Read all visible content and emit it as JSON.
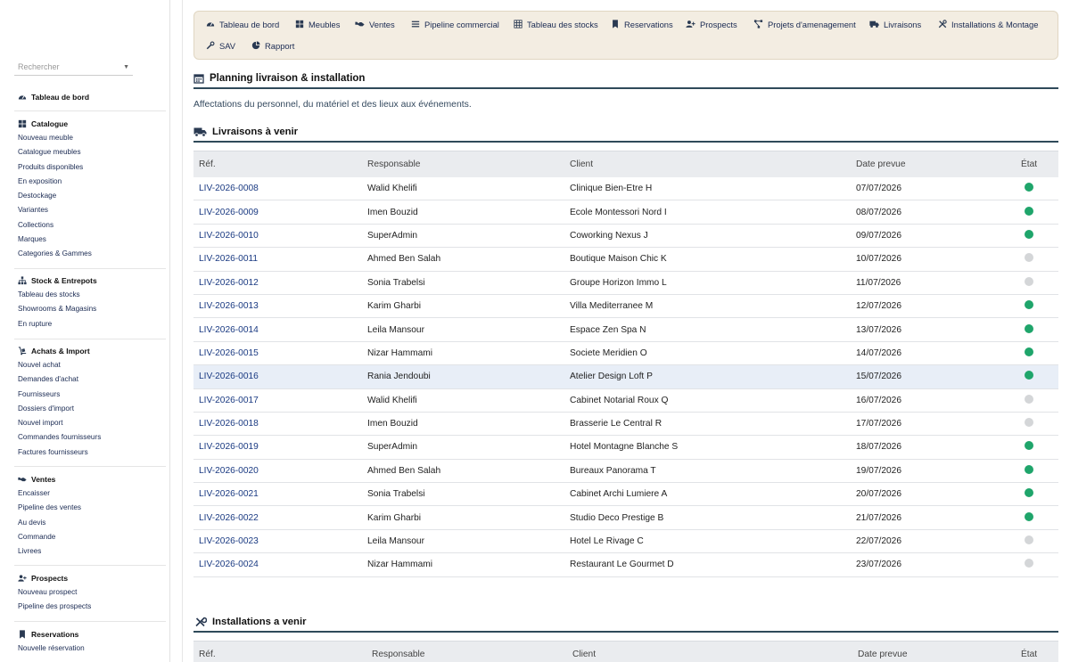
{
  "search": {
    "placeholder": "Rechercher"
  },
  "sidebar": {
    "sections": [
      {
        "title": "Tableau de bord",
        "icon": "gauge-icon",
        "items": []
      },
      {
        "title": "Catalogue",
        "icon": "grid-icon",
        "items": [
          "Nouveau meuble",
          "Catalogue meubles",
          "Produits disponibles",
          "En exposition",
          "Destockage",
          "Variantes",
          "Collections",
          "Marques",
          "Categories & Gammes"
        ]
      },
      {
        "title": "Stock & Entrepots",
        "icon": "sitemap-icon",
        "items": [
          "Tableau des stocks",
          "Showrooms & Magasins",
          "En rupture"
        ]
      },
      {
        "title": "Achats & Import",
        "icon": "dolly-icon",
        "items": [
          "Nouvel achat",
          "Demandes d'achat",
          "Fournisseurs",
          "Dossiers d'import",
          "Nouvel import",
          "Commandes fournisseurs",
          "Factures fournisseurs"
        ]
      },
      {
        "title": "Ventes",
        "icon": "handshake-icon",
        "items": [
          "Encaisser",
          "Pipeline des ventes",
          "Au devis",
          "Commande",
          "Livrees"
        ]
      },
      {
        "title": "Prospects",
        "icon": "user-plus-icon",
        "items": [
          "Nouveau prospect",
          "Pipeline des prospects"
        ]
      },
      {
        "title": "Reservations",
        "icon": "bookmark-icon",
        "items": [
          "Nouvelle réservation"
        ]
      }
    ]
  },
  "topbar": {
    "items": [
      {
        "label": "Tableau de bord",
        "icon": "gauge-icon"
      },
      {
        "label": "Meubles",
        "icon": "grid-icon"
      },
      {
        "label": "Ventes",
        "icon": "handshake-icon"
      },
      {
        "label": "Pipeline commercial",
        "icon": "bars-icon"
      },
      {
        "label": "Tableau des stocks",
        "icon": "table-icon"
      },
      {
        "label": "Reservations",
        "icon": "bookmark-icon"
      },
      {
        "label": "Prospects",
        "icon": "user-plus-icon"
      },
      {
        "label": "Projets d'amenagement",
        "icon": "project-diagram-icon"
      },
      {
        "label": "Livraisons",
        "icon": "truck-icon"
      },
      {
        "label": "Installations & Montage",
        "icon": "tools-icon"
      },
      {
        "label": "SAV",
        "icon": "wrench-icon"
      },
      {
        "label": "Rapport",
        "icon": "chart-pie-icon"
      }
    ]
  },
  "page": {
    "title": "Planning livraison & installation",
    "subtitle": "Affectations du personnel, du matériel et des lieux aux événements."
  },
  "deliveries": {
    "title": "Livraisons à venir",
    "columns": [
      "Réf.",
      "Responsable",
      "Client",
      "Date prevue",
      "État"
    ],
    "rows": [
      {
        "ref": "LIV-2026-0008",
        "resp": "Walid Khelifi",
        "client": "Clinique Bien-Etre H",
        "date": "07/07/2026",
        "state": "green"
      },
      {
        "ref": "LIV-2026-0009",
        "resp": "Imen Bouzid",
        "client": "Ecole Montessori Nord I",
        "date": "08/07/2026",
        "state": "green"
      },
      {
        "ref": "LIV-2026-0010",
        "resp": "SuperAdmin",
        "client": "Coworking Nexus J",
        "date": "09/07/2026",
        "state": "green"
      },
      {
        "ref": "LIV-2026-0011",
        "resp": "Ahmed Ben Salah",
        "client": "Boutique Maison Chic K",
        "date": "10/07/2026",
        "state": "gray"
      },
      {
        "ref": "LIV-2026-0012",
        "resp": "Sonia Trabelsi",
        "client": "Groupe Horizon Immo L",
        "date": "11/07/2026",
        "state": "gray"
      },
      {
        "ref": "LIV-2026-0013",
        "resp": "Karim Gharbi",
        "client": "Villa Mediterranee M",
        "date": "12/07/2026",
        "state": "green"
      },
      {
        "ref": "LIV-2026-0014",
        "resp": "Leila Mansour",
        "client": "Espace Zen Spa N",
        "date": "13/07/2026",
        "state": "green"
      },
      {
        "ref": "LIV-2026-0015",
        "resp": "Nizar Hammami",
        "client": "Societe Meridien O",
        "date": "14/07/2026",
        "state": "green"
      },
      {
        "ref": "LIV-2026-0016",
        "resp": "Rania Jendoubi",
        "client": "Atelier Design Loft P",
        "date": "15/07/2026",
        "state": "green",
        "highlight": true
      },
      {
        "ref": "LIV-2026-0017",
        "resp": "Walid Khelifi",
        "client": "Cabinet Notarial Roux Q",
        "date": "16/07/2026",
        "state": "gray"
      },
      {
        "ref": "LIV-2026-0018",
        "resp": "Imen Bouzid",
        "client": "Brasserie Le Central R",
        "date": "17/07/2026",
        "state": "gray"
      },
      {
        "ref": "LIV-2026-0019",
        "resp": "SuperAdmin",
        "client": "Hotel Montagne Blanche S",
        "date": "18/07/2026",
        "state": "green"
      },
      {
        "ref": "LIV-2026-0020",
        "resp": "Ahmed Ben Salah",
        "client": "Bureaux Panorama T",
        "date": "19/07/2026",
        "state": "green"
      },
      {
        "ref": "LIV-2026-0021",
        "resp": "Sonia Trabelsi",
        "client": "Cabinet Archi Lumiere A",
        "date": "20/07/2026",
        "state": "green"
      },
      {
        "ref": "LIV-2026-0022",
        "resp": "Karim Gharbi",
        "client": "Studio Deco Prestige B",
        "date": "21/07/2026",
        "state": "green"
      },
      {
        "ref": "LIV-2026-0023",
        "resp": "Leila Mansour",
        "client": "Hotel Le Rivage C",
        "date": "22/07/2026",
        "state": "gray"
      },
      {
        "ref": "LIV-2026-0024",
        "resp": "Nizar Hammami",
        "client": "Restaurant Le Gourmet D",
        "date": "23/07/2026",
        "state": "gray"
      }
    ]
  },
  "installations": {
    "title": "Installations a venir",
    "columns": [
      "Réf.",
      "Responsable",
      "Client",
      "Date prevue",
      "État"
    ]
  },
  "colors": {
    "green": "#1fa56b",
    "gray": "#d4d6d8",
    "accent": "#2f4a5a",
    "link": "#1a3a82"
  }
}
